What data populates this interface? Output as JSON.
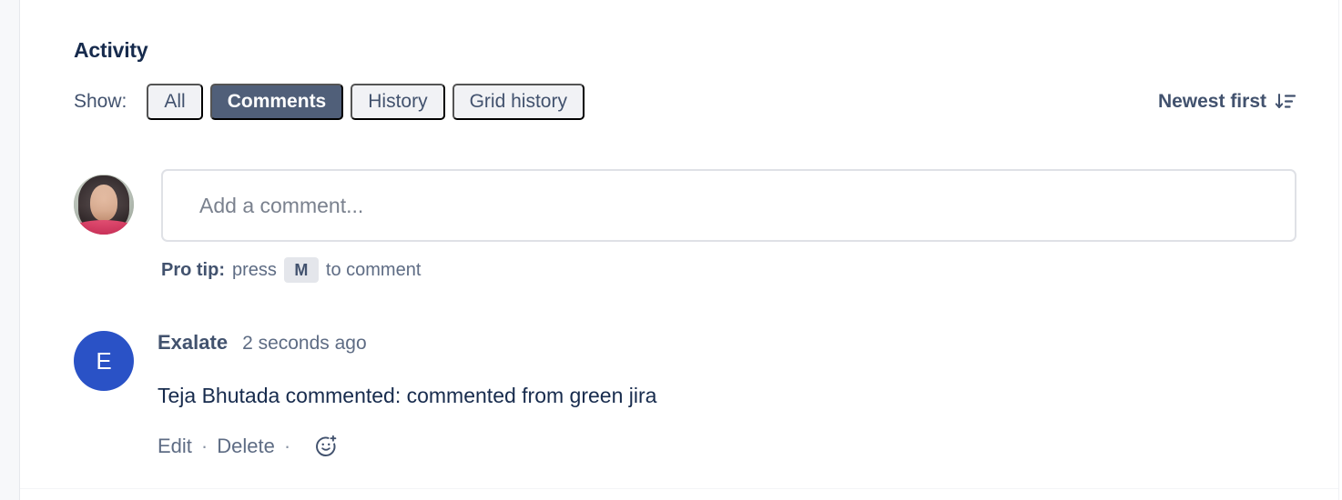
{
  "panel": {
    "title": "Activity"
  },
  "filters": {
    "show_label": "Show:",
    "options": [
      {
        "label": "All",
        "selected": false
      },
      {
        "label": "Comments",
        "selected": true
      },
      {
        "label": "History",
        "selected": false
      },
      {
        "label": "Grid history",
        "selected": false
      }
    ]
  },
  "sort": {
    "label": "Newest first",
    "icon": "sort-descending-icon"
  },
  "composer": {
    "avatar_icon": "user-photo-avatar",
    "placeholder": "Add a comment...",
    "pro_tip_prefix": "Pro tip:",
    "pro_tip_press": "press",
    "pro_tip_key": "M",
    "pro_tip_suffix": "to comment"
  },
  "comments": [
    {
      "avatar_initial": "E",
      "avatar_color": "#2A52C6",
      "author": "Exalate",
      "timestamp": "2 seconds ago",
      "text": "Teja Bhutada commented: commented from green jira",
      "actions": {
        "edit": "Edit",
        "separator": "·",
        "delete": "Delete",
        "separator2": "·",
        "reaction_icon": "add-reaction-icon"
      }
    }
  ],
  "colors": {
    "selected_chip_bg": "#505F79",
    "chip_bg": "#F1F2F5",
    "text_primary": "#172B4D",
    "text_subtle": "#5E6C84"
  }
}
